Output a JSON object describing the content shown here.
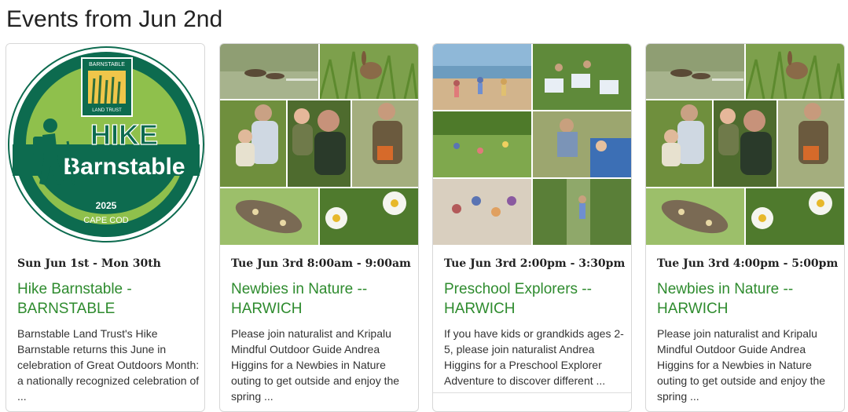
{
  "page": {
    "heading": "Events from Jun 2nd"
  },
  "cards": [
    {
      "date": "Sun Jun 1st - Mon 30th",
      "title": "Hike Barnstable - BARNSTABLE",
      "description": "Barnstable Land Trust's Hike Barnstable returns this June in celebration of Great Outdoors Month: a nationally recognized celebration of ...",
      "logo": {
        "top_text": "BARNSTABLE",
        "bottom_text": "LAND TRUST",
        "line1": "HIKE",
        "line2": "Barnstable",
        "year": "2025",
        "region": "CAPE COD"
      }
    },
    {
      "date": "Tue Jun 3rd 8:00am - 9:00am",
      "title": "Newbies in Nature -- HARWICH",
      "description": "Please join naturalist and Kripalu Mindful Outdoor Guide Andrea Higgins for a Newbies in Nature outing to get outside and enjoy the spring ..."
    },
    {
      "date": "Tue Jun 3rd 2:00pm - 3:30pm",
      "title": "Preschool Explorers -- HARWICH",
      "description": "If you have kids or grandkids ages 2-5, please join naturalist Andrea Higgins for a Preschool Explorer Adventure to discover different ..."
    },
    {
      "date": "Tue Jun 3rd 4:00pm - 5:00pm",
      "title": "Newbies in Nature -- HARWICH",
      "description": "Please join naturalist and Kripalu Mindful Outdoor Guide Andrea Higgins for a Newbies in Nature outing to get outside and enjoy the spring ..."
    }
  ],
  "colors": {
    "link": "#2e8b2e",
    "logo_dark": "#0d6b4f",
    "logo_light": "#8fc04c"
  }
}
